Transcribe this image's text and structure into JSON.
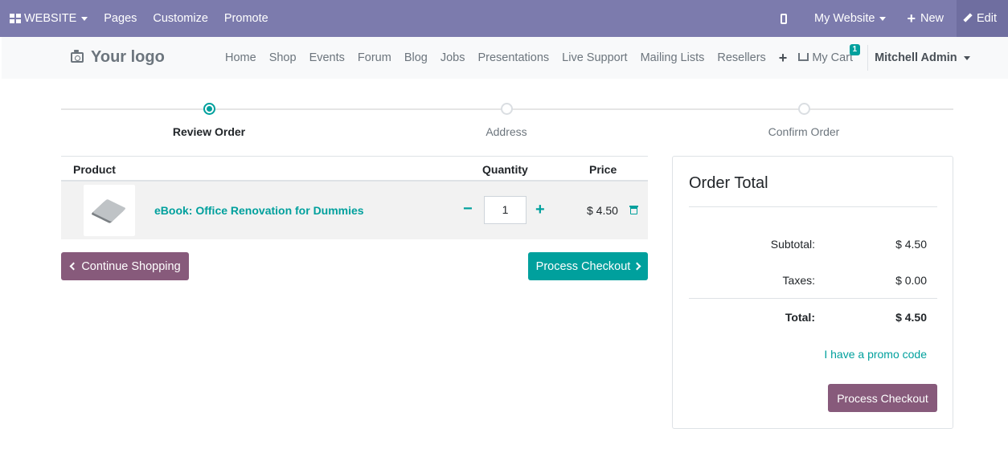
{
  "admin_bar": {
    "website_label": "WEBSITE",
    "pages_label": "Pages",
    "customize_label": "Customize",
    "promote_label": "Promote",
    "my_website_label": "My Website",
    "new_label": "New",
    "edit_label": "Edit"
  },
  "site_nav": {
    "logo_text": "Your logo",
    "links": [
      "Home",
      "Shop",
      "Events",
      "Forum",
      "Blog",
      "Jobs",
      "Presentations",
      "Live Support",
      "Mailing Lists",
      "Resellers"
    ],
    "cart_label": "My Cart",
    "cart_count": "1",
    "user_name": "Mitchell Admin"
  },
  "wizard": {
    "steps": [
      "Review Order",
      "Address",
      "Confirm Order"
    ],
    "active_step": 0
  },
  "cart_table": {
    "headers": {
      "product": "Product",
      "quantity": "Quantity",
      "price": "Price"
    },
    "rows": [
      {
        "name": "eBook: Office Renovation for Dummies",
        "quantity": "1",
        "price": "$ 4.50"
      }
    ]
  },
  "actions": {
    "continue_label": "Continue Shopping",
    "checkout_label": "Process Checkout"
  },
  "order_total": {
    "title": "Order Total",
    "subtotal_label": "Subtotal:",
    "subtotal_value": "$ 4.50",
    "taxes_label": "Taxes:",
    "taxes_value": "$ 0.00",
    "total_label": "Total:",
    "total_value": "$ 4.50",
    "promo_label": "I have a promo code",
    "checkout_label": "Process Checkout"
  },
  "colors": {
    "admin_bar": "#7c7bad",
    "accent": "#00a09d",
    "primary_button": "#875a7b"
  }
}
